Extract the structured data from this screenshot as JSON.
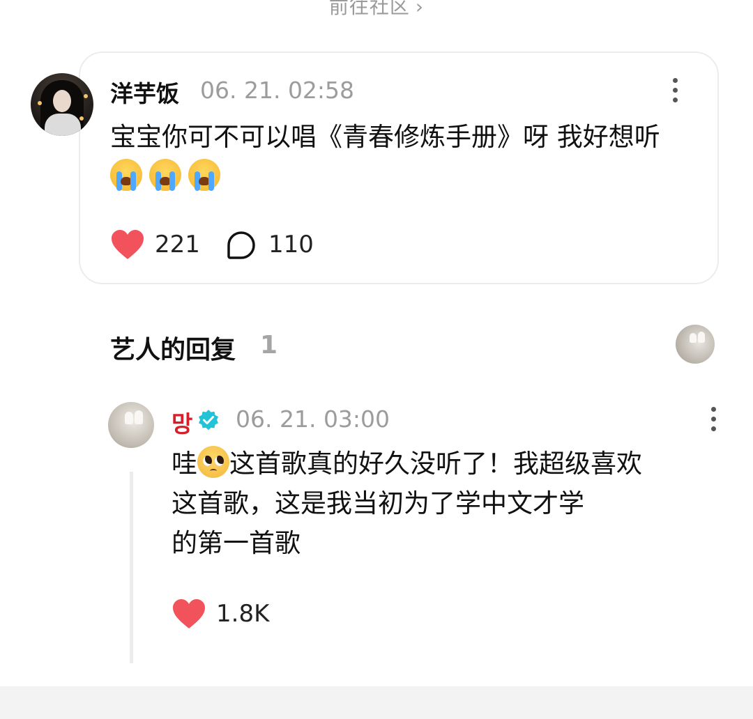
{
  "top_link": {
    "label": "前往社区",
    "chevron": "›"
  },
  "comment": {
    "username": "洋芋饭",
    "timestamp": "06. 21. 02:58",
    "text": "宝宝你可不可以唱《青春修炼手册》呀 我好想听",
    "emojis": [
      "loudly-crying-face",
      "loudly-crying-face",
      "loudly-crying-face"
    ],
    "likes": "221",
    "replies": "110"
  },
  "section": {
    "title": "艺人的回复",
    "count": "1"
  },
  "reply": {
    "artist_name": "망",
    "verified": true,
    "timestamp": "06. 21. 03:00",
    "text_line1_before_emoji": "哇",
    "emoji": "pleading-face",
    "text_line1_after_emoji": "这首歌真的好久没听了！我超级喜欢",
    "text_line2": "这首歌，这是我当初为了学中文才学",
    "text_line3": "的第一首歌",
    "likes": "1.8K"
  },
  "colors": {
    "heart": "#f2525c",
    "artist_name": "#d61f28",
    "verified": "#22c3d6",
    "muted_text": "#9c9c9c",
    "card_border": "#ececec"
  }
}
